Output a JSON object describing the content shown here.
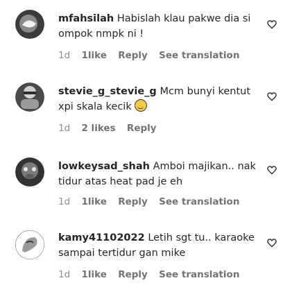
{
  "comments": [
    {
      "username": "mfahsilah",
      "text": "Habislah klau pakwe dia si ompok nmpk ni !",
      "time": "1d",
      "likes": "1like",
      "reply": "Reply",
      "translate": "See translation",
      "has_emoji": false,
      "avatar_icon": "avatar-photo-icon"
    },
    {
      "username": "stevie_g_stevie_g",
      "text": "Mcm bunyi kentut xpi skala kecik",
      "time": "1d",
      "likes": "2 likes",
      "reply": "Reply",
      "translate": "",
      "has_emoji": true,
      "emoji_name": "grinning-face-emoji",
      "avatar_icon": "avatar-photo-icon"
    },
    {
      "username": "lowkeysad_shah",
      "text": "Amboi majikan.. nak tidur atas heat pad je eh",
      "time": "1d",
      "likes": "1like",
      "reply": "Reply",
      "translate": "See translation",
      "has_emoji": false,
      "avatar_icon": "avatar-photo-icon"
    },
    {
      "username": "kamy41102022",
      "text": "Letih sgt tu.. karaoke sampai tertidur gan mike",
      "time": "1d",
      "likes": "1like",
      "reply": "Reply",
      "translate": "See translation",
      "has_emoji": false,
      "avatar_icon": "avatar-photo-icon"
    }
  ],
  "colors": {
    "text": "#262626",
    "meta": "#8e8e8e",
    "avatar_bg": "#ffffff"
  }
}
